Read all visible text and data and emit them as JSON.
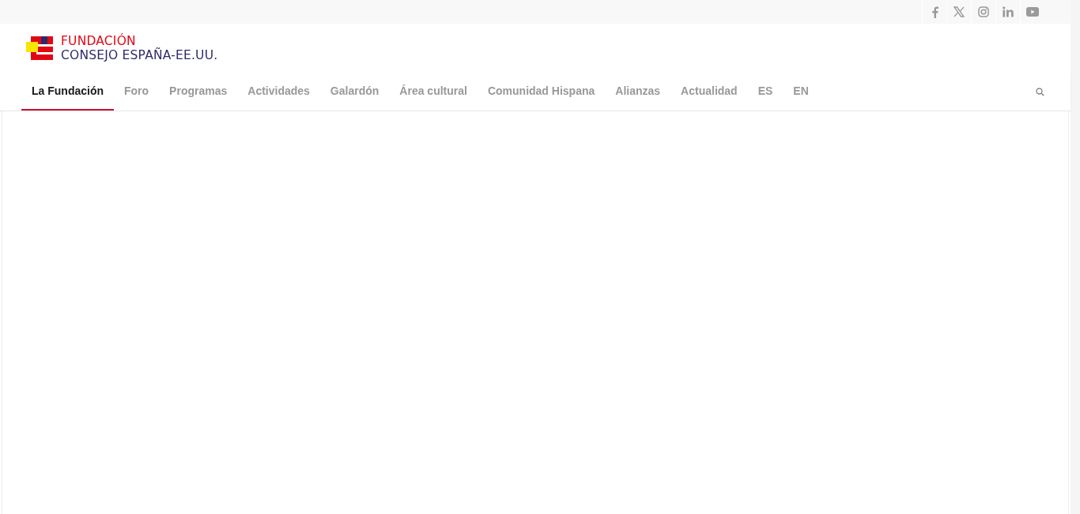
{
  "social_links": [
    {
      "kind": "facebook"
    },
    {
      "kind": "x"
    },
    {
      "kind": "instagram"
    },
    {
      "kind": "linkedin"
    },
    {
      "kind": "youtube"
    }
  ],
  "logo": {
    "line_1": "FUNDACIÓN",
    "line_2": "CONSEJO ESPAÑA-EE.UU."
  },
  "nav": [
    {
      "label": "La Fundación",
      "selected": true
    },
    {
      "label": "Foro",
      "selected": false
    },
    {
      "label": "Programas",
      "selected": false
    },
    {
      "label": "Actividades",
      "selected": false
    },
    {
      "label": "Galardón",
      "selected": false
    },
    {
      "label": "Área cultural",
      "selected": false
    },
    {
      "label": "Comunidad Hispana",
      "selected": false
    },
    {
      "label": "Alianzas",
      "selected": false
    },
    {
      "label": "Actualidad",
      "selected": false
    },
    {
      "label": "ES",
      "selected": false
    },
    {
      "label": "EN",
      "selected": false
    }
  ]
}
